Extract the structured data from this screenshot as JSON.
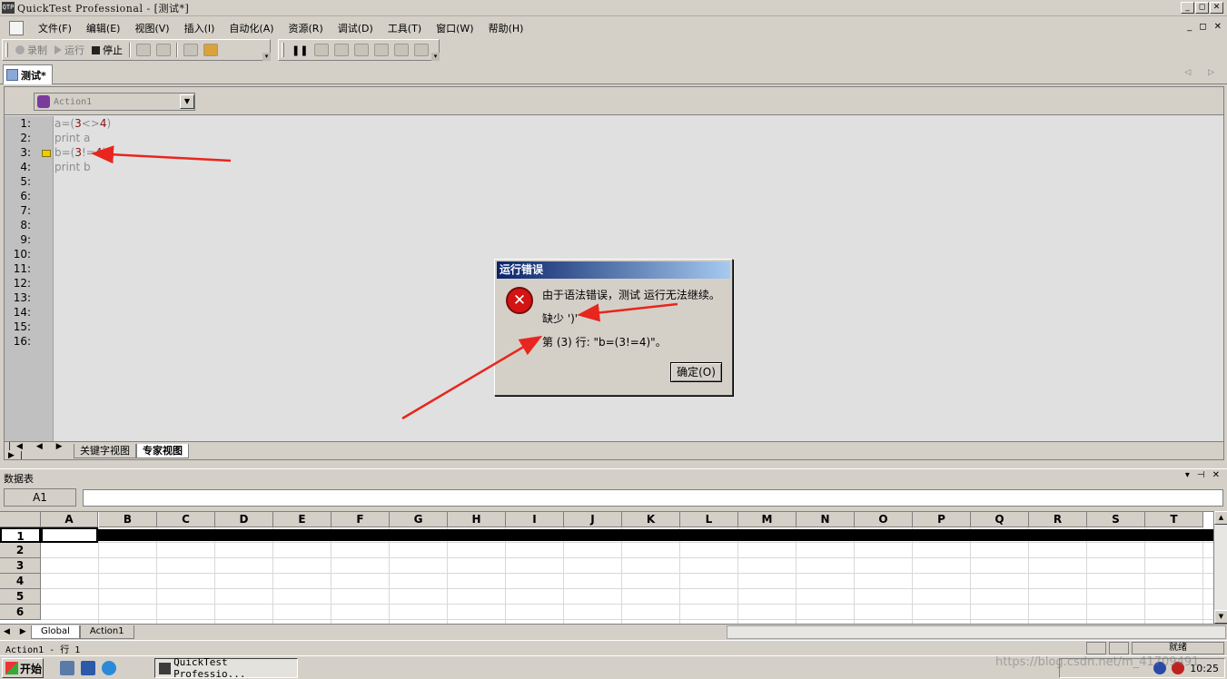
{
  "window": {
    "title": "QuickTest Professional - [测试*]",
    "app_icon_text": "QTP",
    "min_label": "_",
    "max_label": "◻",
    "close_label": "✕"
  },
  "menubar": {
    "items": [
      "文件(F)",
      "编辑(E)",
      "视图(V)",
      "插入(I)",
      "自动化(A)",
      "资源(R)",
      "调试(D)",
      "工具(T)",
      "窗口(W)",
      "帮助(H)"
    ],
    "mdi_min": "_",
    "mdi_restore": "◻",
    "mdi_close": "✕"
  },
  "toolbar": {
    "record_label": "录制",
    "run_label": "运行",
    "stop_label": "停止"
  },
  "doc_tab": {
    "label": "测试*",
    "nav": "◁ ▷"
  },
  "editor": {
    "action_combo_value": "Action1",
    "line_numbers": [
      "1:",
      "2:",
      "3:",
      "4:",
      "5:",
      "6:",
      "7:",
      "8:",
      "9:",
      "10:",
      "11:",
      "12:",
      "13:",
      "14:",
      "15:",
      "16:"
    ],
    "code": {
      "line1_a": "a=(",
      "line1_n1": "3",
      "line1_op": "<>",
      "line1_n2": "4",
      "line1_end": ")",
      "line2": "print a",
      "line3_a": "b=(",
      "line3_n1": "3",
      "line3_op": "!=",
      "line3_n2": "4",
      "line3_end": ")",
      "line4": "print b"
    },
    "execution_line": 3,
    "nav_arrows": "|◀ ◀ ▶ ▶|",
    "view_tabs": [
      "关键字视图",
      "专家视图"
    ],
    "active_view": "专家视图"
  },
  "error_dialog": {
    "title": "运行错误",
    "message": "由于语法错误，测试 运行无法继续。",
    "detail": "缺少 ')'",
    "location": "第 (3) 行: \"b=(3!=4)\"。",
    "ok_label": "确定(O)",
    "icon_glyph": "✕"
  },
  "datatable": {
    "title": "数据表",
    "ctrls": [
      "▾",
      "⊣",
      "✕"
    ],
    "cell_ref": "A1",
    "formula_value": "",
    "columns": [
      "A",
      "B",
      "C",
      "D",
      "E",
      "F",
      "G",
      "H",
      "I",
      "J",
      "K",
      "L",
      "M",
      "N",
      "O",
      "P",
      "Q",
      "R",
      "S",
      "T"
    ],
    "rows": [
      "1",
      "2",
      "3",
      "4",
      "5",
      "6"
    ],
    "selected_row": "1",
    "sheet_tabs": [
      "Global",
      "Action1"
    ],
    "active_sheet": "Global"
  },
  "statusbar": {
    "left": "Action1  - 行  1",
    "right": "就绪"
  },
  "taskbar": {
    "start_label": "开始",
    "task_label": "QuickTest Professio...",
    "clock": "10:25",
    "watermark": "https://blog.csdn.net/m_41709491"
  },
  "colors": {
    "chrome": "#d4d0c8",
    "editor_bg": "#e0e0e0",
    "code_text": "#8c8c8c",
    "number": "#8a1010",
    "annotation_arrow": "#e8251e",
    "dialog_title_start": "#0a246a",
    "dialog_title_end": "#a6caf0"
  }
}
